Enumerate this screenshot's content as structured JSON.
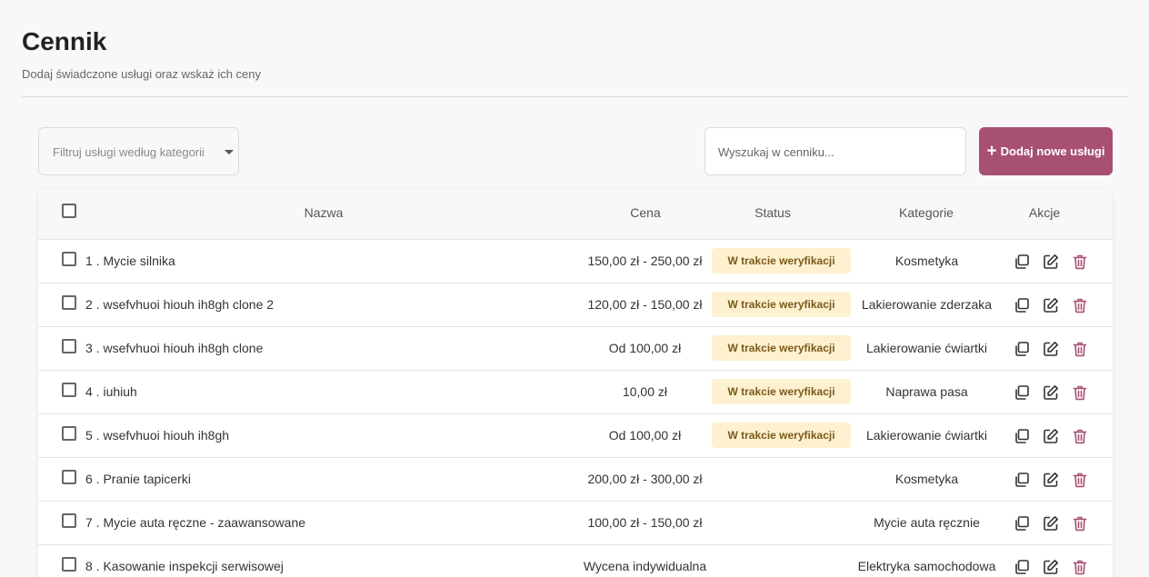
{
  "header": {
    "title": "Cennik",
    "subtitle": "Dodaj świadczone usługi oraz wskaż ich ceny"
  },
  "toolbar": {
    "filter_placeholder": "Filtruj usługi według kategorii",
    "search_placeholder": "Wyszukaj w cenniku...",
    "add_button_icon": "+",
    "add_button_label": "Dodaj nowe usługi"
  },
  "table": {
    "columns": {
      "name": "Nazwa",
      "price": "Cena",
      "status": "Status",
      "category": "Kategorie",
      "actions": "Akcje"
    },
    "rows": [
      {
        "index": "1 .",
        "name": "Mycie silnika",
        "price": "150,00 zł - 250,00 zł",
        "status": "W trakcie weryfikacji",
        "category": "Kosmetyka"
      },
      {
        "index": "2 .",
        "name": "wsefvhuoi hiouh ih8gh clone 2",
        "price": "120,00 zł - 150,00 zł",
        "status": "W trakcie weryfikacji",
        "category": "Lakierowanie zderzaka"
      },
      {
        "index": "3 .",
        "name": "wsefvhuoi hiouh ih8gh clone",
        "price": "Od 100,00 zł",
        "status": "W trakcie weryfikacji",
        "category": "Lakierowanie ćwiartki"
      },
      {
        "index": "4 .",
        "name": "iuhiuh",
        "price": "10,00 zł",
        "status": "W trakcie weryfikacji",
        "category": "Naprawa pasa"
      },
      {
        "index": "5 .",
        "name": "wsefvhuoi hiouh ih8gh",
        "price": "Od 100,00 zł",
        "status": "W trakcie weryfikacji",
        "category": "Lakierowanie ćwiartki"
      },
      {
        "index": "6 .",
        "name": "Pranie tapicerki",
        "price": "200,00 zł - 300,00 zł",
        "status": "",
        "category": "Kosmetyka"
      },
      {
        "index": "7 .",
        "name": "Mycie auta ręczne - zaawansowane",
        "price": "100,00 zł - 150,00 zł",
        "status": "",
        "category": "Mycie auta ręcznie"
      },
      {
        "index": "8 .",
        "name": "Kasowanie inspekcji serwisowej",
        "price": "Wycena indywidualna",
        "status": "",
        "category": "Elektryka samochodowa"
      }
    ]
  },
  "colors": {
    "accent": "#a84f74",
    "badge_bg": "#fdf1cf",
    "badge_text": "#7a5a1c",
    "delete_icon": "#a84f74"
  },
  "icons": {
    "filter": "chevron-down-icon",
    "add": "plus-icon",
    "copy": "copy-icon",
    "edit": "edit-icon",
    "delete": "trash-icon"
  }
}
